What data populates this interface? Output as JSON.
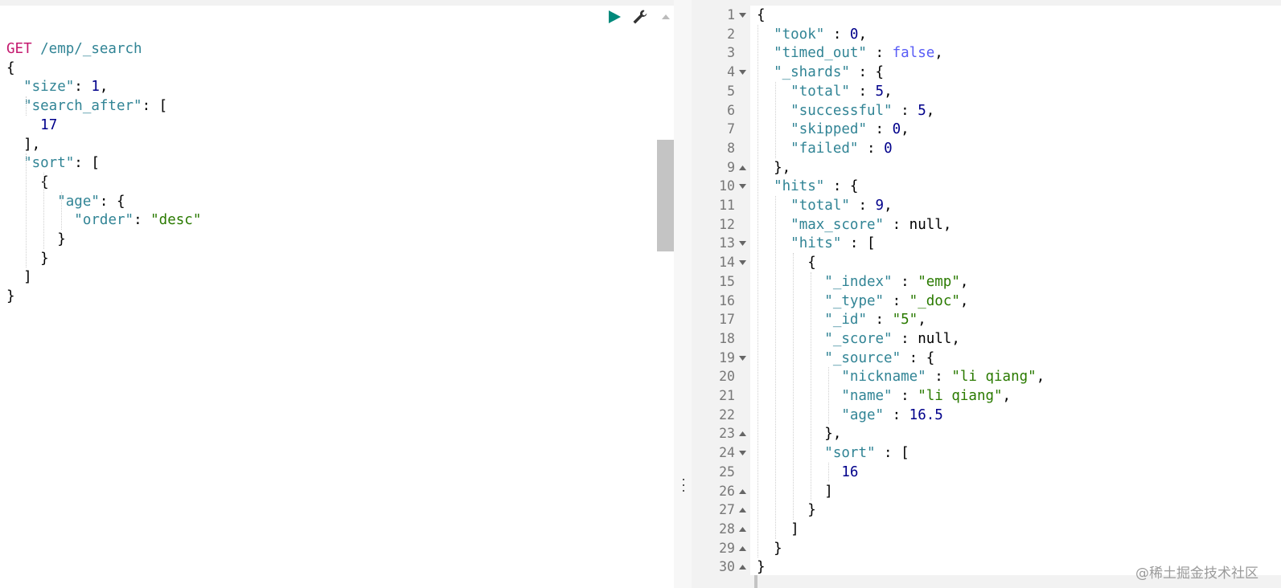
{
  "left_editor": {
    "request_line": {
      "method": "GET",
      "path": " /emp/_search"
    },
    "lines": [
      [
        [
          "p",
          "{"
        ]
      ],
      [
        [
          "p",
          "  "
        ],
        [
          "key",
          "\"size\""
        ],
        [
          "p",
          ": "
        ],
        [
          "num",
          "1"
        ],
        [
          "p",
          ","
        ]
      ],
      [
        [
          "p",
          "  "
        ],
        [
          "key",
          "\"search_after\""
        ],
        [
          "p",
          ": ["
        ]
      ],
      [
        [
          "p",
          "    "
        ],
        [
          "num",
          "17"
        ]
      ],
      [
        [
          "p",
          "  ],"
        ]
      ],
      [
        [
          "p",
          "  "
        ],
        [
          "key",
          "\"sort\""
        ],
        [
          "p",
          ": ["
        ]
      ],
      [
        [
          "p",
          "    {"
        ]
      ],
      [
        [
          "p",
          "      "
        ],
        [
          "key",
          "\"age\""
        ],
        [
          "p",
          ": {"
        ]
      ],
      [
        [
          "p",
          "        "
        ],
        [
          "key",
          "\"order\""
        ],
        [
          "p",
          ": "
        ],
        [
          "str",
          "\"desc\""
        ]
      ],
      [
        [
          "p",
          "      }"
        ]
      ],
      [
        [
          "p",
          "    }"
        ]
      ],
      [
        [
          "p",
          "  ]"
        ]
      ],
      [
        [
          "p",
          "}"
        ]
      ]
    ]
  },
  "toolbar": {
    "run_icon": "play-icon",
    "settings_icon": "wrench-icon",
    "collapse_icon": "caret-up-icon",
    "accent": "#00897b"
  },
  "right_editor": {
    "line_numbers": [
      "1",
      "2",
      "3",
      "4",
      "5",
      "6",
      "7",
      "8",
      "9",
      "10",
      "11",
      "12",
      "13",
      "14",
      "15",
      "16",
      "17",
      "18",
      "19",
      "20",
      "21",
      "22",
      "23",
      "24",
      "25",
      "26",
      "27",
      "28",
      "29",
      "30"
    ],
    "fold_markers": {
      "1": "down",
      "4": "down",
      "9": "up",
      "10": "down",
      "13": "down",
      "14": "down",
      "19": "down",
      "23": "up",
      "24": "down",
      "26": "up",
      "27": "up",
      "28": "up",
      "29": "up",
      "30": "up"
    },
    "lines": [
      [
        [
          "p",
          "{"
        ]
      ],
      [
        [
          "p",
          "  "
        ],
        [
          "key",
          "\"took\""
        ],
        [
          "p",
          " : "
        ],
        [
          "num",
          "0"
        ],
        [
          "p",
          ","
        ]
      ],
      [
        [
          "p",
          "  "
        ],
        [
          "key",
          "\"timed_out\""
        ],
        [
          "p",
          " : "
        ],
        [
          "bool",
          "false"
        ],
        [
          "p",
          ","
        ]
      ],
      [
        [
          "p",
          "  "
        ],
        [
          "key",
          "\"_shards\""
        ],
        [
          "p",
          " : {"
        ]
      ],
      [
        [
          "p",
          "    "
        ],
        [
          "key",
          "\"total\""
        ],
        [
          "p",
          " : "
        ],
        [
          "num",
          "5"
        ],
        [
          "p",
          ","
        ]
      ],
      [
        [
          "p",
          "    "
        ],
        [
          "key",
          "\"successful\""
        ],
        [
          "p",
          " : "
        ],
        [
          "num",
          "5"
        ],
        [
          "p",
          ","
        ]
      ],
      [
        [
          "p",
          "    "
        ],
        [
          "key",
          "\"skipped\""
        ],
        [
          "p",
          " : "
        ],
        [
          "num",
          "0"
        ],
        [
          "p",
          ","
        ]
      ],
      [
        [
          "p",
          "    "
        ],
        [
          "key",
          "\"failed\""
        ],
        [
          "p",
          " : "
        ],
        [
          "num",
          "0"
        ]
      ],
      [
        [
          "p",
          "  },"
        ]
      ],
      [
        [
          "p",
          "  "
        ],
        [
          "key",
          "\"hits\""
        ],
        [
          "p",
          " : {"
        ]
      ],
      [
        [
          "p",
          "    "
        ],
        [
          "key",
          "\"total\""
        ],
        [
          "p",
          " : "
        ],
        [
          "num",
          "9"
        ],
        [
          "p",
          ","
        ]
      ],
      [
        [
          "p",
          "    "
        ],
        [
          "key",
          "\"max_score\""
        ],
        [
          "p",
          " : null,"
        ]
      ],
      [
        [
          "p",
          "    "
        ],
        [
          "key",
          "\"hits\""
        ],
        [
          "p",
          " : ["
        ]
      ],
      [
        [
          "p",
          "      {"
        ]
      ],
      [
        [
          "p",
          "        "
        ],
        [
          "key",
          "\"_index\""
        ],
        [
          "p",
          " : "
        ],
        [
          "str",
          "\"emp\""
        ],
        [
          "p",
          ","
        ]
      ],
      [
        [
          "p",
          "        "
        ],
        [
          "key",
          "\"_type\""
        ],
        [
          "p",
          " : "
        ],
        [
          "str",
          "\"_doc\""
        ],
        [
          "p",
          ","
        ]
      ],
      [
        [
          "p",
          "        "
        ],
        [
          "key",
          "\"_id\""
        ],
        [
          "p",
          " : "
        ],
        [
          "str",
          "\"5\""
        ],
        [
          "p",
          ","
        ]
      ],
      [
        [
          "p",
          "        "
        ],
        [
          "key",
          "\"_score\""
        ],
        [
          "p",
          " : null,"
        ]
      ],
      [
        [
          "p",
          "        "
        ],
        [
          "key",
          "\"_source\""
        ],
        [
          "p",
          " : {"
        ]
      ],
      [
        [
          "p",
          "          "
        ],
        [
          "key",
          "\"nickname\""
        ],
        [
          "p",
          " : "
        ],
        [
          "str",
          "\"li qiang\""
        ],
        [
          "p",
          ","
        ]
      ],
      [
        [
          "p",
          "          "
        ],
        [
          "key",
          "\"name\""
        ],
        [
          "p",
          " : "
        ],
        [
          "str",
          "\"li qiang\""
        ],
        [
          "p",
          ","
        ]
      ],
      [
        [
          "p",
          "          "
        ],
        [
          "key",
          "\"age\""
        ],
        [
          "p",
          " : "
        ],
        [
          "num",
          "16.5"
        ]
      ],
      [
        [
          "p",
          "        },"
        ]
      ],
      [
        [
          "p",
          "        "
        ],
        [
          "key",
          "\"sort\""
        ],
        [
          "p",
          " : ["
        ]
      ],
      [
        [
          "p",
          "          "
        ],
        [
          "num",
          "16"
        ]
      ],
      [
        [
          "p",
          "        ]"
        ]
      ],
      [
        [
          "p",
          "      }"
        ]
      ],
      [
        [
          "p",
          "    ]"
        ]
      ],
      [
        [
          "p",
          "  }"
        ]
      ],
      [
        [
          "p",
          "}"
        ]
      ]
    ]
  },
  "watermark": "@稀土掘金技术社区"
}
